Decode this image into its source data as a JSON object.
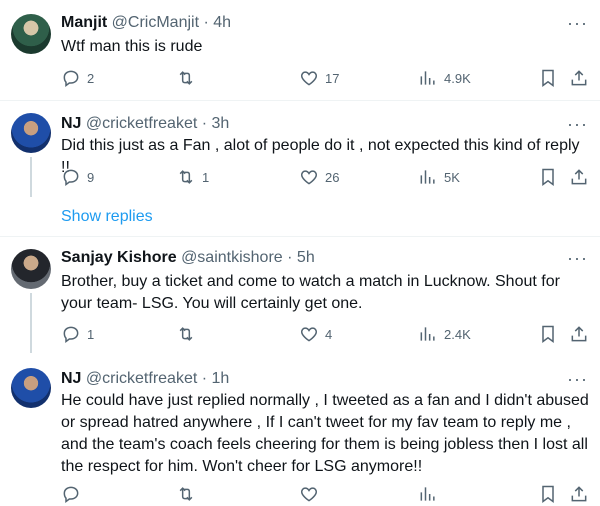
{
  "tweets": [
    {
      "name": "Manjit",
      "handle": "@CricManjit",
      "time": "4h",
      "text": "Wtf man this is rude",
      "replies": "2",
      "retweets": "",
      "likes": "17",
      "views": "4.9K"
    },
    {
      "name": "NJ",
      "handle": "@cricketfreaket",
      "time": "3h",
      "text": "Did this just as a Fan , alot of people do it , not expected this kind of reply !!",
      "replies": "9",
      "retweets": "1",
      "likes": "26",
      "views": "5K"
    },
    {
      "name": "Sanjay Kishore",
      "handle": "@saintkishore",
      "time": "5h",
      "text": "Brother, buy a ticket and come to watch a match in Lucknow. Shout for your team- LSG. You will certainly get one.",
      "replies": "1",
      "retweets": "",
      "likes": "4",
      "views": "2.4K"
    },
    {
      "name": "NJ",
      "handle": "@cricketfreaket",
      "time": "1h",
      "text": "He could have just replied normally , I tweeted as a fan and I didn't abused or spread hatred anywhere , If I can't tweet for my fav team to reply me , and the team's coach feels cheering for them is being jobless then I lost all the respect for him. Won't cheer for LSG anymore!!",
      "replies": "",
      "retweets": "",
      "likes": "",
      "views": ""
    }
  ],
  "show_replies_label": "Show replies",
  "separator": "·",
  "more_label": "···",
  "icons": {
    "reply": "reply-icon",
    "retweet": "retweet-icon",
    "like": "heart-icon",
    "views": "views-icon",
    "bookmark": "bookmark-icon",
    "share": "share-icon"
  }
}
